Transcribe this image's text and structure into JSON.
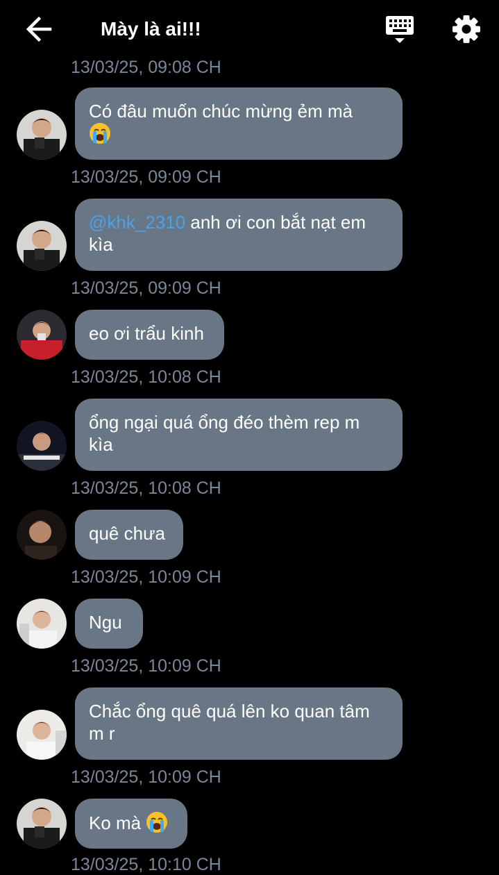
{
  "header": {
    "title": "Mày là ai!!!"
  },
  "messages": [
    {
      "text": "Có đâu muốn chúc mừng ẻm mà",
      "emoji": "crying-emoji",
      "timestamp": "13/03/25, 09:09 CH"
    },
    {
      "mention": "@khk_2310",
      "text": " anh ơi con bắt nạt em kìa",
      "timestamp": "13/03/25, 09:09 CH"
    },
    {
      "text": "eo ơi trẩu kinh",
      "timestamp": "13/03/25, 10:08 CH"
    },
    {
      "text": "ổng ngại quá ổng đéo thèm rep m kìa",
      "timestamp": "13/03/25, 10:08 CH"
    },
    {
      "text": "quê chưa",
      "timestamp": "13/03/25, 10:09 CH"
    },
    {
      "text": "Ngu",
      "timestamp": "13/03/25, 10:09 CH"
    },
    {
      "text": "Chắc ổng quê quá lên ko quan tâm m r",
      "timestamp": "13/03/25, 10:09 CH"
    },
    {
      "text": "Ko mà",
      "emoji": "crying-emoji",
      "timestamp": "13/03/25, 10:10 CH"
    }
  ],
  "partial_top_timestamp": "13/03/25, 09:08 CH",
  "colors": {
    "background": "#000000",
    "bubble": "#687685",
    "timestamp": "#7a8798",
    "mention": "#4aa3e8"
  }
}
